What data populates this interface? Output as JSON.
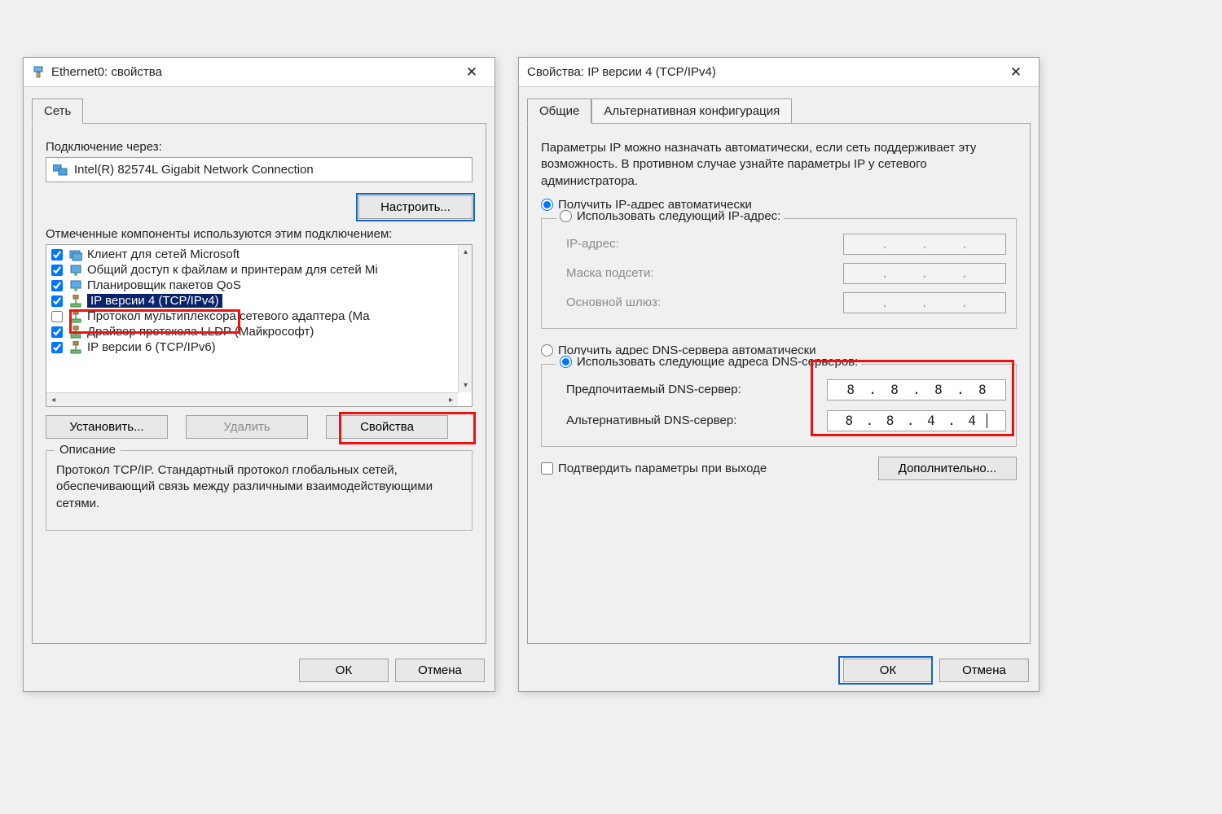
{
  "left": {
    "title": "Ethernet0: свойства",
    "tab_network": "Сеть",
    "connect_label": "Подключение через:",
    "adapter": "Intel(R) 82574L Gigabit Network Connection",
    "btn_configure": "Настроить...",
    "components_label": "Отмеченные компоненты используются этим подключением:",
    "items": [
      {
        "checked": true,
        "icon": "client",
        "label": "Клиент для сетей Microsoft"
      },
      {
        "checked": true,
        "icon": "service",
        "label": "Общий доступ к файлам и принтерам для сетей Mi"
      },
      {
        "checked": true,
        "icon": "service",
        "label": "Планировщик пакетов QoS"
      },
      {
        "checked": true,
        "icon": "protocol",
        "label": "IP версии 4 (TCP/IPv4)",
        "selected": true
      },
      {
        "checked": false,
        "icon": "protocol",
        "label": "Протокол мультиплексора сетевого адаптера (Ма"
      },
      {
        "checked": true,
        "icon": "protocol",
        "label": "Драйвер протокола LLDP (Майкрософт)"
      },
      {
        "checked": true,
        "icon": "protocol",
        "label": "IP версии 6 (TCP/IPv6)"
      }
    ],
    "btn_install": "Установить...",
    "btn_remove": "Удалить",
    "btn_properties": "Свойства",
    "desc_caption": "Описание",
    "desc_text": "Протокол TCP/IP. Стандартный протокол глобальных сетей, обеспечивающий связь между различными взаимодействующими сетями.",
    "btn_ok": "ОК",
    "btn_cancel": "Отмена"
  },
  "right": {
    "title": "Свойства: IP версии 4 (TCP/IPv4)",
    "tab_general": "Общие",
    "tab_alt": "Альтернативная конфигурация",
    "intro": "Параметры IP можно назначать автоматически, если сеть поддерживает эту возможность. В противном случае узнайте параметры IP у сетевого администратора.",
    "radio_ip_auto": "Получить IP-адрес автоматически",
    "radio_ip_manual": "Использовать следующий IP-адрес:",
    "lbl_ip": "IP-адрес:",
    "lbl_mask": "Маска подсети:",
    "lbl_gateway": "Основной шлюз:",
    "radio_dns_auto": "Получить адрес DNS-сервера автоматически",
    "radio_dns_manual": "Использовать следующие адреса DNS-серверов:",
    "lbl_dns1": "Предпочитаемый DNS-сервер:",
    "lbl_dns2": "Альтернативный DNS-сервер:",
    "dns1": [
      "8",
      "8",
      "8",
      "8"
    ],
    "dns2": [
      "8",
      "8",
      "4",
      "4"
    ],
    "chk_validate": "Подтвердить параметры при выходе",
    "btn_advanced": "Дополнительно...",
    "btn_ok": "ОК",
    "btn_cancel": "Отмена"
  }
}
